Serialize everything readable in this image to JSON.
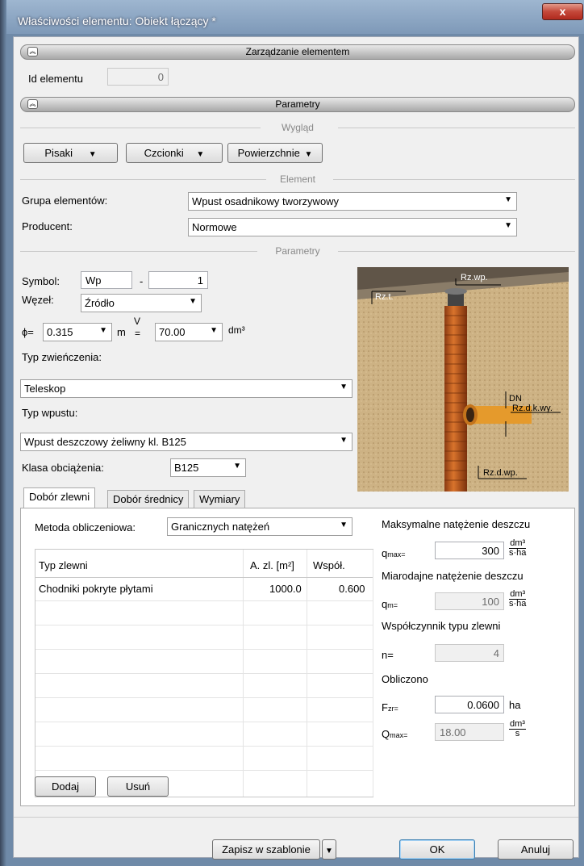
{
  "window": {
    "title": "Właściwości elementu: Obiekt łączący *",
    "close_label": "x"
  },
  "sections": {
    "management": "Zarządzanie elementem",
    "parameters": "Parametry"
  },
  "id_field": {
    "label": "Id elementu",
    "value": "0"
  },
  "groups": {
    "appearance": "Wygląd",
    "element": "Element",
    "params": "Parametry"
  },
  "appearance_buttons": {
    "pens": "Pisaki",
    "fonts": "Czcionki",
    "surfaces": "Powierzchnie"
  },
  "element": {
    "group_label": "Grupa elementów:",
    "group_value": "Wpust osadnikowy tworzywowy",
    "producer_label": "Producent:",
    "producer_value": "Normowe"
  },
  "params": {
    "symbol_label": "Symbol:",
    "symbol_value": "Wp",
    "symbol_sep": "-",
    "symbol_num": "1",
    "node_label": "Węzeł:",
    "node_value": "Źródło",
    "phi_label": "ϕ=",
    "phi_value": "0.315",
    "phi_unit": "m",
    "v_label_top": "V",
    "v_label_bot": "=",
    "v_value": "70.00",
    "v_unit": "dm³",
    "top_type_label": "Typ zwieńczenia:",
    "top_type_value": "Teleskop",
    "inlet_type_label": "Typ wpustu:",
    "inlet_type_value": "Wpust deszczowy żeliwny kl. B125",
    "load_class_label": "Klasa obciążenia:",
    "load_class_value": "B125"
  },
  "diagram": {
    "rzt": "Rz.t.",
    "rzwp": "Rz.wp.",
    "dn": "DN",
    "rzdkwy": "Rz.d.k.wy.",
    "rzdwp": "Rz.d.wp."
  },
  "tabs": [
    "Dobór zlewni",
    "Dobór średnicy",
    "Wymiary"
  ],
  "catchment": {
    "method_label": "Metoda obliczeniowa:",
    "method_value": "Granicznych natężeń",
    "columns": [
      "Typ zlewni",
      "A. zl. [m²]",
      "Współ."
    ],
    "rows": [
      {
        "type": "Chodniki pokryte płytami",
        "area": "1000.0",
        "coef": "0.600"
      }
    ],
    "add_label": "Dodaj",
    "remove_label": "Usuń"
  },
  "calc": {
    "max_rain_label": "Maksymalne natężenie deszczu",
    "qmax_sym": "q",
    "qmax_sub": "max=",
    "qmax_value": "300",
    "unit_num": "dm³",
    "unit_den": "s·ha",
    "design_rain_label": "Miarodajne natężenie deszczu",
    "qm_sym": "q",
    "qm_sub": "m=",
    "qm_value": "100",
    "coef_label": "Współczynnik typu zlewni",
    "n_label": "n=",
    "n_value": "4",
    "computed_label": "Obliczono",
    "fzr_sym": "F",
    "fzr_sub": "zr=",
    "fzr_value": "0.0600",
    "fzr_unit": "ha",
    "Qmax_sym": "Q",
    "Qmax_sub": "max=",
    "Qmax_value": "18.00",
    "Q_unit_num": "dm³",
    "Q_unit_den": "s"
  },
  "footer": {
    "save_template": "Zapisz w szablonie",
    "ok": "OK",
    "cancel": "Anuluj"
  }
}
